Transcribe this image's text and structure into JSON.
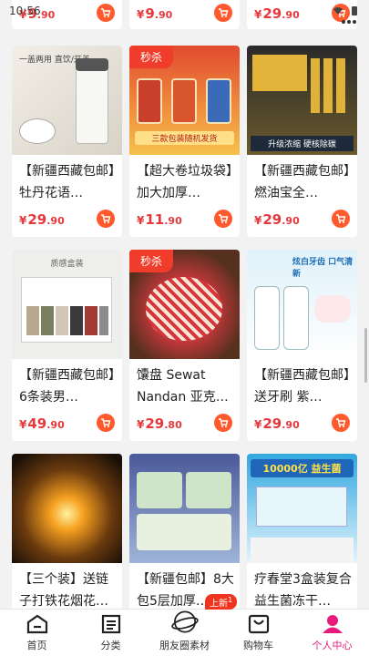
{
  "status": {
    "time": "10:56"
  },
  "colors": {
    "accent": "#ff5a2d",
    "price": "#e4393c",
    "active_tab": "#e81b7d",
    "seckill": "#f03c2b"
  },
  "products": [
    {
      "title": "",
      "price_int": "9",
      "price_dec": ".90",
      "currency": "¥",
      "badge": ""
    },
    {
      "title": "",
      "price_int": "9",
      "price_dec": ".90",
      "currency": "¥",
      "badge": ""
    },
    {
      "title": "",
      "price_int": "29",
      "price_dec": ".90",
      "currency": "¥",
      "badge": ""
    },
    {
      "title": "【新疆西藏包邮】牡丹花语…",
      "price_int": "29",
      "price_dec": ".90",
      "currency": "¥",
      "badge": "",
      "thumb_text": "一盖两用 直饮/开盖"
    },
    {
      "title": "【超大卷垃圾袋】加大加厚…",
      "price_int": "11",
      "price_dec": ".90",
      "currency": "¥",
      "badge": "秒杀",
      "thumb_text": "三款包装随机发货"
    },
    {
      "title": "【新疆西藏包邮】燃油宝全…",
      "price_int": "29",
      "price_dec": ".90",
      "currency": "¥",
      "badge": "",
      "thumb_text": "升级浓缩 硬核除碳"
    },
    {
      "title": "【新疆西藏包邮】6条装男…",
      "price_int": "49",
      "price_dec": ".90",
      "currency": "¥",
      "badge": "",
      "thumb_text": "质感盒装"
    },
    {
      "title": "馕盘 Sewat Nandan 亚克…",
      "price_int": "29",
      "price_dec": ".80",
      "currency": "¥",
      "badge": "秒杀"
    },
    {
      "title": "【新疆西藏包邮】送牙刷 紫…",
      "price_int": "29",
      "price_dec": ".90",
      "currency": "¥",
      "badge": "",
      "thumb_text": "炫白牙齿 口气清新"
    },
    {
      "title": "【三个装】送链子打铁花烟花…",
      "price_int": "",
      "price_dec": "",
      "currency": "",
      "badge": ""
    },
    {
      "title": "【新疆包邮】8大包5层加厚…",
      "price_int": "",
      "price_dec": "",
      "currency": "",
      "badge": ""
    },
    {
      "title": "疗春堂3盒装复合益生菌冻干…",
      "price_int": "",
      "price_dec": "",
      "currency": "",
      "badge": "",
      "thumb_text": "10000亿 益生菌"
    }
  ],
  "tabbar": {
    "home": "首页",
    "category": "分类",
    "moments": "朋友圈素材",
    "cart": "购物车",
    "profile": "个人中心",
    "new_badge": "上新",
    "new_count": "1"
  }
}
